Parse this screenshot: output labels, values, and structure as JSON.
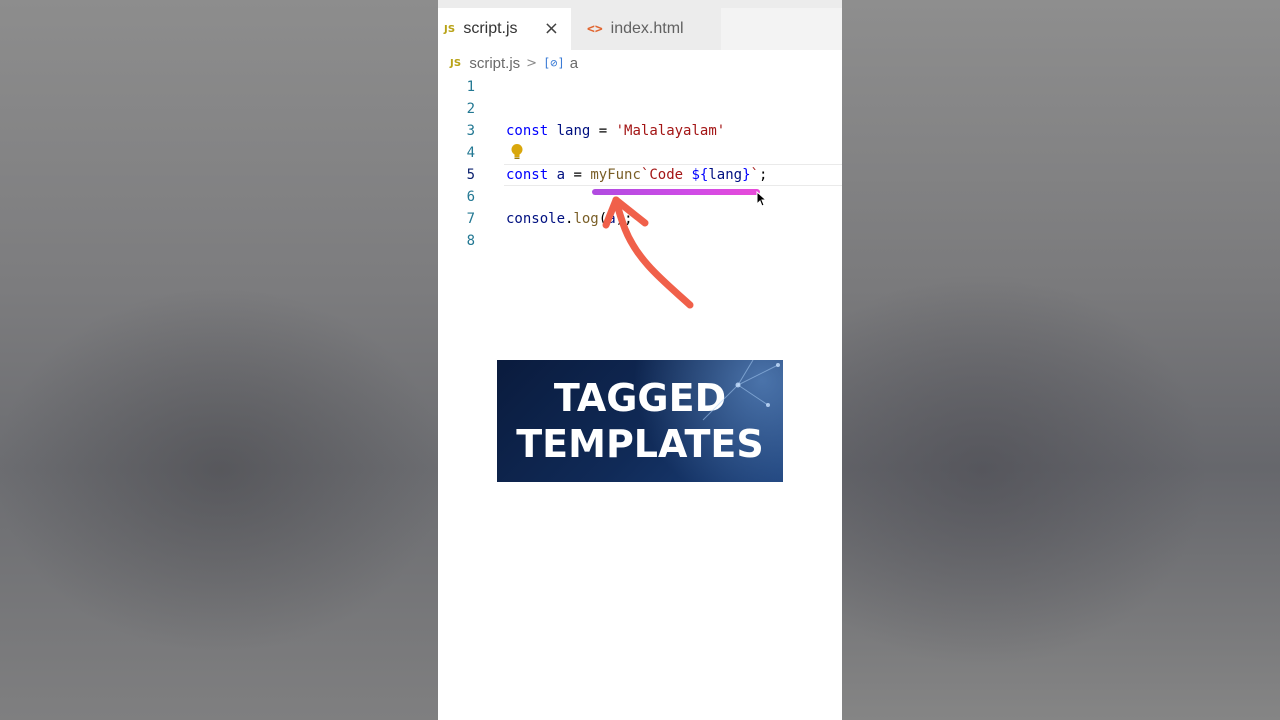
{
  "tabs": [
    {
      "badge": "JS",
      "label": "script.js",
      "active": true,
      "close": "×"
    },
    {
      "badge": "<>",
      "label": "index.html",
      "active": false
    }
  ],
  "breadcrumb": {
    "badge": "JS",
    "file": "script.js",
    "separator": ">",
    "symbol_icon": "[⊘]",
    "symbol": "a"
  },
  "editor": {
    "current_line": 5,
    "lines": [
      {
        "n": "1",
        "code": ""
      },
      {
        "n": "2",
        "code": ""
      },
      {
        "n": "3",
        "code": "const lang = 'Malalayalam'"
      },
      {
        "n": "4",
        "code": ""
      },
      {
        "n": "5",
        "code": "const a = myFunc`Code ${lang}`;"
      },
      {
        "n": "6",
        "code": ""
      },
      {
        "n": "7",
        "code": "console.log(a);"
      },
      {
        "n": "8",
        "code": ""
      }
    ]
  },
  "overlay": {
    "title_line1": "TAGGED",
    "title_line2": "TEMPLATES"
  },
  "colors": {
    "keyword": "#0000ff",
    "variable": "#001080",
    "string": "#a31515",
    "function": "#795e26",
    "underline": "#c84be4",
    "arrow": "#f0604a"
  },
  "icons": [
    "js-file-icon",
    "html-file-icon",
    "close-icon",
    "lightbulb-icon",
    "mouse-cursor-icon",
    "annotation-arrow-icon"
  ]
}
